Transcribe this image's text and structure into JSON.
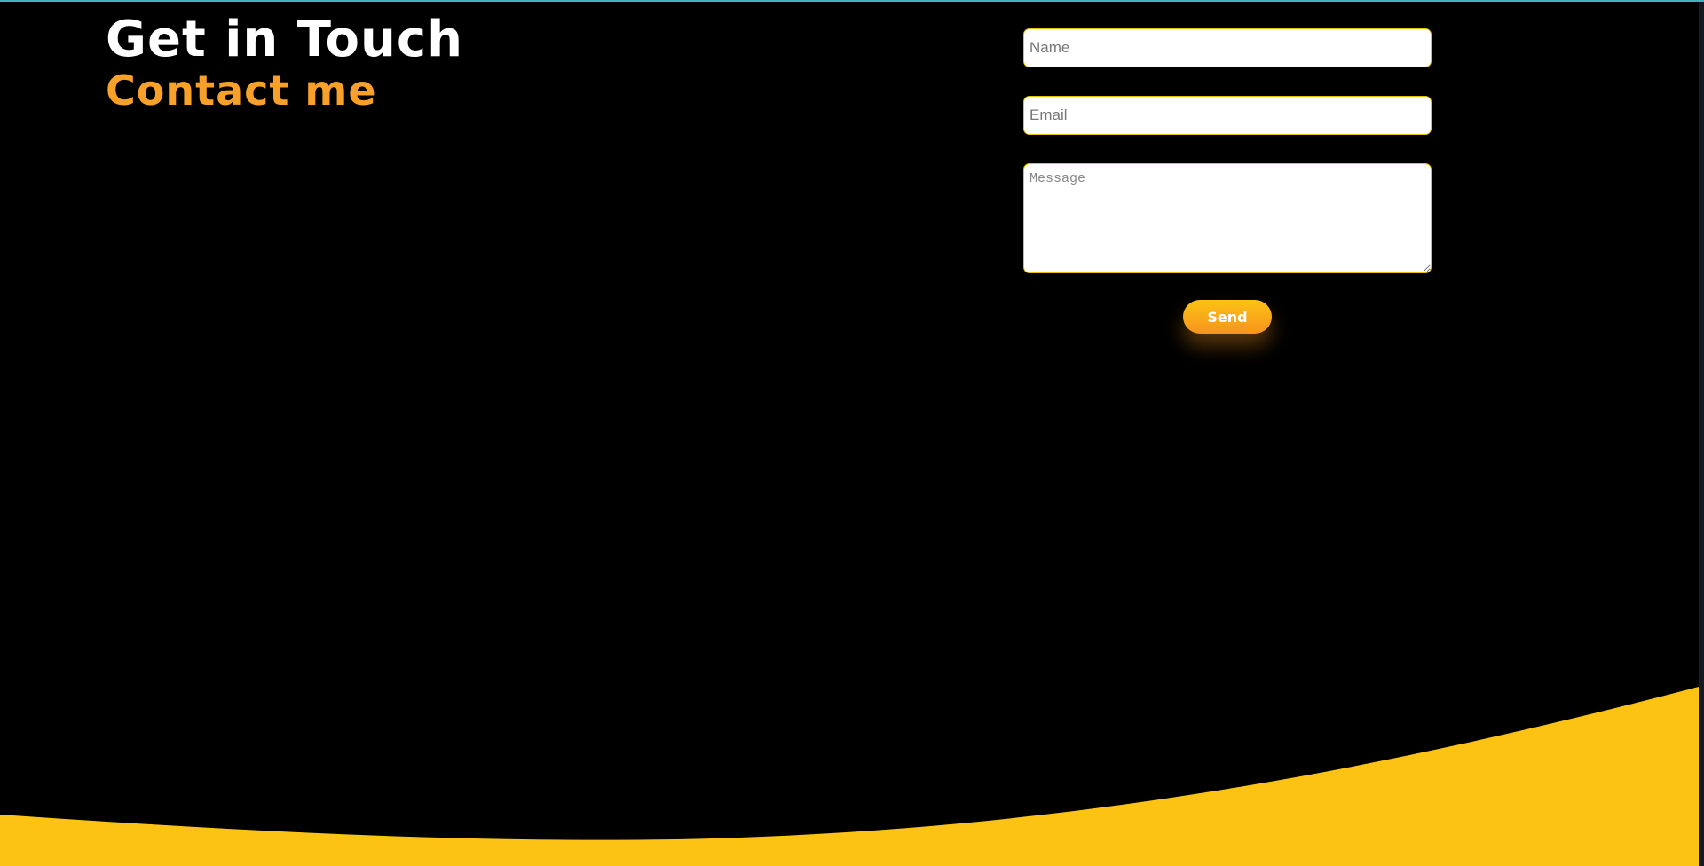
{
  "colors": {
    "background": "#000000",
    "accent_orange": "#f7a12a",
    "footer_yellow": "#fcc314",
    "top_line": "#3fb3b9",
    "button_gradient_start": "#fcc314",
    "button_gradient_end": "#f7931e"
  },
  "header": {
    "title": "Get in Touch",
    "subtitle": "Contact me"
  },
  "form": {
    "name_placeholder": "Name",
    "name_value": "",
    "email_placeholder": "Email",
    "email_value": "",
    "message_placeholder": "Message",
    "message_value": "",
    "send_label": "Send"
  }
}
